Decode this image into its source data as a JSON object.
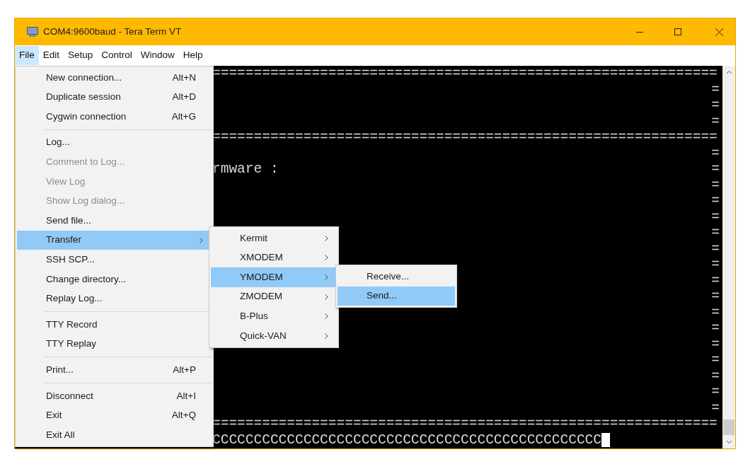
{
  "window": {
    "title": "COM4:9600baud - Tera Term VT"
  },
  "menu_bar": [
    {
      "label": "File",
      "selected": true
    },
    {
      "label": "Edit",
      "selected": false
    },
    {
      "label": "Setup",
      "selected": false
    },
    {
      "label": "Control",
      "selected": false
    },
    {
      "label": "Window",
      "selected": false
    },
    {
      "label": "Help",
      "selected": false
    }
  ],
  "file_menu": {
    "items": [
      {
        "kind": "item",
        "label": "New connection...",
        "shortcut": "Alt+N",
        "disabled": false,
        "selected": false,
        "submenu": false
      },
      {
        "kind": "item",
        "label": "Duplicate session",
        "shortcut": "Alt+D",
        "disabled": false,
        "selected": false,
        "submenu": false
      },
      {
        "kind": "item",
        "label": "Cygwin connection",
        "shortcut": "Alt+G",
        "disabled": false,
        "selected": false,
        "submenu": false
      },
      {
        "kind": "separator"
      },
      {
        "kind": "item",
        "label": "Log...",
        "disabled": false,
        "selected": false,
        "submenu": false
      },
      {
        "kind": "item",
        "label": "Comment to Log...",
        "disabled": true,
        "selected": false,
        "submenu": false
      },
      {
        "kind": "item",
        "label": "View Log",
        "disabled": true,
        "selected": false,
        "submenu": false
      },
      {
        "kind": "item",
        "label": "Show Log dialog...",
        "disabled": true,
        "selected": false,
        "submenu": false
      },
      {
        "kind": "item",
        "label": "Send file...",
        "disabled": false,
        "selected": false,
        "submenu": false
      },
      {
        "kind": "item",
        "label": "Transfer",
        "disabled": false,
        "selected": true,
        "submenu": true
      },
      {
        "kind": "item",
        "label": "SSH SCP...",
        "disabled": false,
        "selected": false,
        "submenu": false
      },
      {
        "kind": "item",
        "label": "Change directory...",
        "disabled": false,
        "selected": false,
        "submenu": false
      },
      {
        "kind": "item",
        "label": "Replay Log...",
        "disabled": false,
        "selected": false,
        "submenu": false
      },
      {
        "kind": "separator"
      },
      {
        "kind": "item",
        "label": "TTY Record",
        "disabled": false,
        "selected": false,
        "submenu": false
      },
      {
        "kind": "item",
        "label": "TTY Replay",
        "disabled": false,
        "selected": false,
        "submenu": false
      },
      {
        "kind": "separator"
      },
      {
        "kind": "item",
        "label": "Print...",
        "shortcut": "Alt+P",
        "disabled": false,
        "selected": false,
        "submenu": false
      },
      {
        "kind": "separator"
      },
      {
        "kind": "item",
        "label": "Disconnect",
        "shortcut": "Alt+I",
        "disabled": false,
        "selected": false,
        "submenu": false
      },
      {
        "kind": "item",
        "label": "Exit",
        "shortcut": "Alt+Q",
        "disabled": false,
        "selected": false,
        "submenu": false
      },
      {
        "kind": "item",
        "label": "Exit All",
        "disabled": false,
        "selected": false,
        "submenu": false
      }
    ]
  },
  "transfer_menu": {
    "items": [
      {
        "kind": "item",
        "label": "Kermit",
        "disabled": false,
        "selected": false,
        "submenu": true
      },
      {
        "kind": "item",
        "label": "XMODEM",
        "disabled": false,
        "selected": false,
        "submenu": true
      },
      {
        "kind": "item",
        "label": "YMODEM",
        "disabled": false,
        "selected": true,
        "submenu": true
      },
      {
        "kind": "item",
        "label": "ZMODEM",
        "disabled": false,
        "selected": false,
        "submenu": true
      },
      {
        "kind": "item",
        "label": "B-Plus",
        "disabled": false,
        "selected": false,
        "submenu": true
      },
      {
        "kind": "item",
        "label": "Quick-VAN",
        "disabled": false,
        "selected": false,
        "submenu": true
      }
    ]
  },
  "ymodem_menu": {
    "items": [
      {
        "kind": "item",
        "label": "Receive...",
        "disabled": false,
        "selected": false,
        "submenu": false
      },
      {
        "kind": "item",
        "label": "Send...",
        "disabled": false,
        "selected": true,
        "submenu": false
      }
    ]
  },
  "terminal": {
    "lines": [
      {
        "left": "============================================================="
      },
      {
        "right": "="
      },
      {
        "right": "="
      },
      {
        "right": "="
      },
      {
        "left": "============================================================="
      },
      {
        "right": "="
      },
      {
        "left": "rmware :",
        "right": "="
      },
      {
        "right": "="
      },
      {
        "right": "="
      },
      {
        "right": "="
      },
      {
        "right": "="
      },
      {
        "right": "="
      },
      {
        "right": "="
      },
      {
        "right": "="
      },
      {
        "right": "="
      },
      {
        "right": "="
      },
      {
        "right": "="
      },
      {
        "right": "="
      },
      {
        "right": "="
      },
      {
        "right": "="
      },
      {
        "right": "="
      },
      {
        "right": "="
      },
      {
        "left": "============================================================="
      },
      {
        "left": "CCCCCCCCCCCCCCCCCCCCCCCCCCCCCCCCCCCCCCCCCCCCCCC",
        "cursor": true
      }
    ]
  }
}
